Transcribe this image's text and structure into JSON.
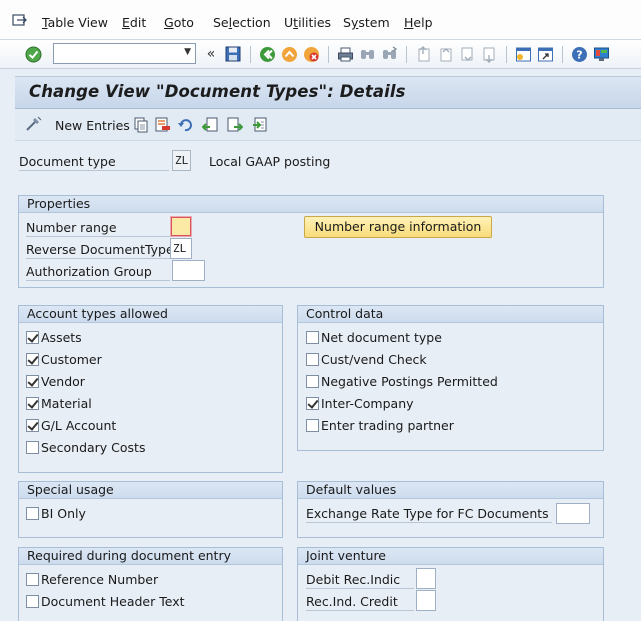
{
  "menu": {
    "items": [
      "Table View",
      "Edit",
      "Goto",
      "Selection",
      "Utilities",
      "System",
      "Help"
    ]
  },
  "toolbar": {
    "command_value": "",
    "icons": [
      "enter-icon",
      "command-field-dropdown-icon",
      "collapse-icon",
      "save-icon",
      "back-icon",
      "exit-icon",
      "cancel-icon",
      "print-icon",
      "find-icon",
      "find-next-icon",
      "first-page-icon",
      "previous-page-icon",
      "next-page-icon",
      "last-page-icon",
      "create-session-icon",
      "create-shortcut-icon",
      "help-icon",
      "customize-layout-icon"
    ]
  },
  "title": "Change View \"Document Types\": Details",
  "app_toolbar": {
    "new_entries": "New Entries"
  },
  "header": {
    "document_type_label": "Document type",
    "document_type_value": "ZL",
    "document_type_desc": "Local GAAP posting"
  },
  "properties": {
    "title": "Properties",
    "number_range_label": "Number range",
    "number_range_value": "",
    "reverse_doc_type_label": "Reverse DocumentType",
    "reverse_doc_type_value": "ZL",
    "authorization_group_label": "Authorization Group",
    "authorization_group_value": "",
    "number_range_info_button": "Number range information"
  },
  "account_types": {
    "title": "Account types allowed",
    "items": [
      {
        "label": "Assets",
        "checked": true
      },
      {
        "label": "Customer",
        "checked": true
      },
      {
        "label": "Vendor",
        "checked": true
      },
      {
        "label": "Material",
        "checked": true
      },
      {
        "label": "G/L Account",
        "checked": true
      },
      {
        "label": "Secondary Costs",
        "checked": false
      }
    ]
  },
  "control_data": {
    "title": "Control data",
    "items": [
      {
        "label": "Net document type",
        "checked": false
      },
      {
        "label": "Cust/vend Check",
        "checked": false
      },
      {
        "label": "Negative Postings Permitted",
        "checked": false
      },
      {
        "label": "Inter-Company",
        "checked": true
      },
      {
        "label": "Enter trading partner",
        "checked": false
      }
    ]
  },
  "special_usage": {
    "title": "Special usage",
    "bi_only_label": "BI Only",
    "bi_only_checked": false
  },
  "default_values": {
    "title": "Default values",
    "exchange_rate_label": "Exchange Rate Type for FC Documents",
    "exchange_rate_value": ""
  },
  "required_entry": {
    "title": "Required during document entry",
    "reference_number_label": "Reference Number",
    "reference_number_checked": false,
    "doc_header_text_label": "Document Header Text",
    "doc_header_text_checked": false
  },
  "joint_venture": {
    "title": "Joint venture",
    "debit_rec_label": "Debit Rec.Indic",
    "debit_rec_value": "",
    "rec_ind_credit_label": "Rec.Ind. Credit",
    "rec_ind_credit_value": ""
  }
}
